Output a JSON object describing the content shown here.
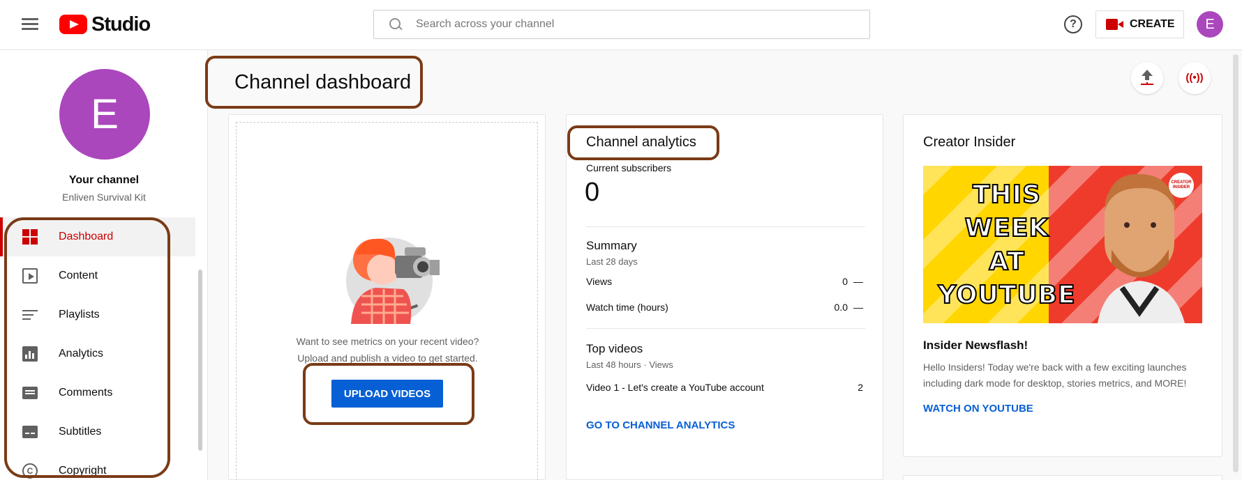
{
  "header": {
    "logo_text": "Studio",
    "search_placeholder": "Search across your channel",
    "help_icon": "?",
    "create_label": "CREATE",
    "avatar_letter": "E"
  },
  "sidebar": {
    "avatar_letter": "E",
    "your_channel": "Your channel",
    "channel_name": "Enliven Survival Kit",
    "items": [
      {
        "label": "Dashboard",
        "icon": "dashboard-icon",
        "active": true
      },
      {
        "label": "Content",
        "icon": "content-icon",
        "active": false
      },
      {
        "label": "Playlists",
        "icon": "playlists-icon",
        "active": false
      },
      {
        "label": "Analytics",
        "icon": "analytics-icon",
        "active": false
      },
      {
        "label": "Comments",
        "icon": "comments-icon",
        "active": false
      },
      {
        "label": "Subtitles",
        "icon": "subtitles-icon",
        "active": false
      },
      {
        "label": "Copyright",
        "icon": "copyright-icon",
        "active": false
      }
    ]
  },
  "main": {
    "title": "Channel dashboard",
    "upload_card": {
      "message_line1": "Want to see metrics on your recent video?",
      "message_line2": "Upload and publish a video to get started.",
      "button_label": "UPLOAD VIDEOS"
    },
    "analytics_card": {
      "title": "Channel analytics",
      "subscribers_label": "Current subscribers",
      "subscribers_value": "0",
      "summary_title": "Summary",
      "summary_period": "Last 28 days",
      "views_label": "Views",
      "views_value": "0",
      "views_change": "—",
      "watch_label": "Watch time (hours)",
      "watch_value": "0.0",
      "watch_change": "—",
      "top_title": "Top videos",
      "top_period": "Last 48 hours · Views",
      "top_videos": [
        {
          "title": "Video 1 - Let's create a YouTube account",
          "views": "2"
        }
      ],
      "link_label": "GO TO CHANNEL ANALYTICS"
    },
    "insider_card": {
      "title": "Creator Insider",
      "thumb_line1": "THIS",
      "thumb_line2": "WEEK",
      "thumb_line3": "AT",
      "thumb_line4": "YOUTUBE",
      "thumb_badge": "CREATOR INSIDER",
      "news_title": "Insider Newsflash!",
      "news_body": "Hello Insiders! Today we're back with a few exciting launches including dark mode for desktop, stories metrics, and MORE!",
      "link_label": "WATCH ON YOUTUBE"
    }
  },
  "colors": {
    "accent_red": "#cc0000",
    "link_blue": "#065fd4",
    "avatar_purple": "#ab47bc",
    "highlight_brown": "#7a3b16"
  }
}
